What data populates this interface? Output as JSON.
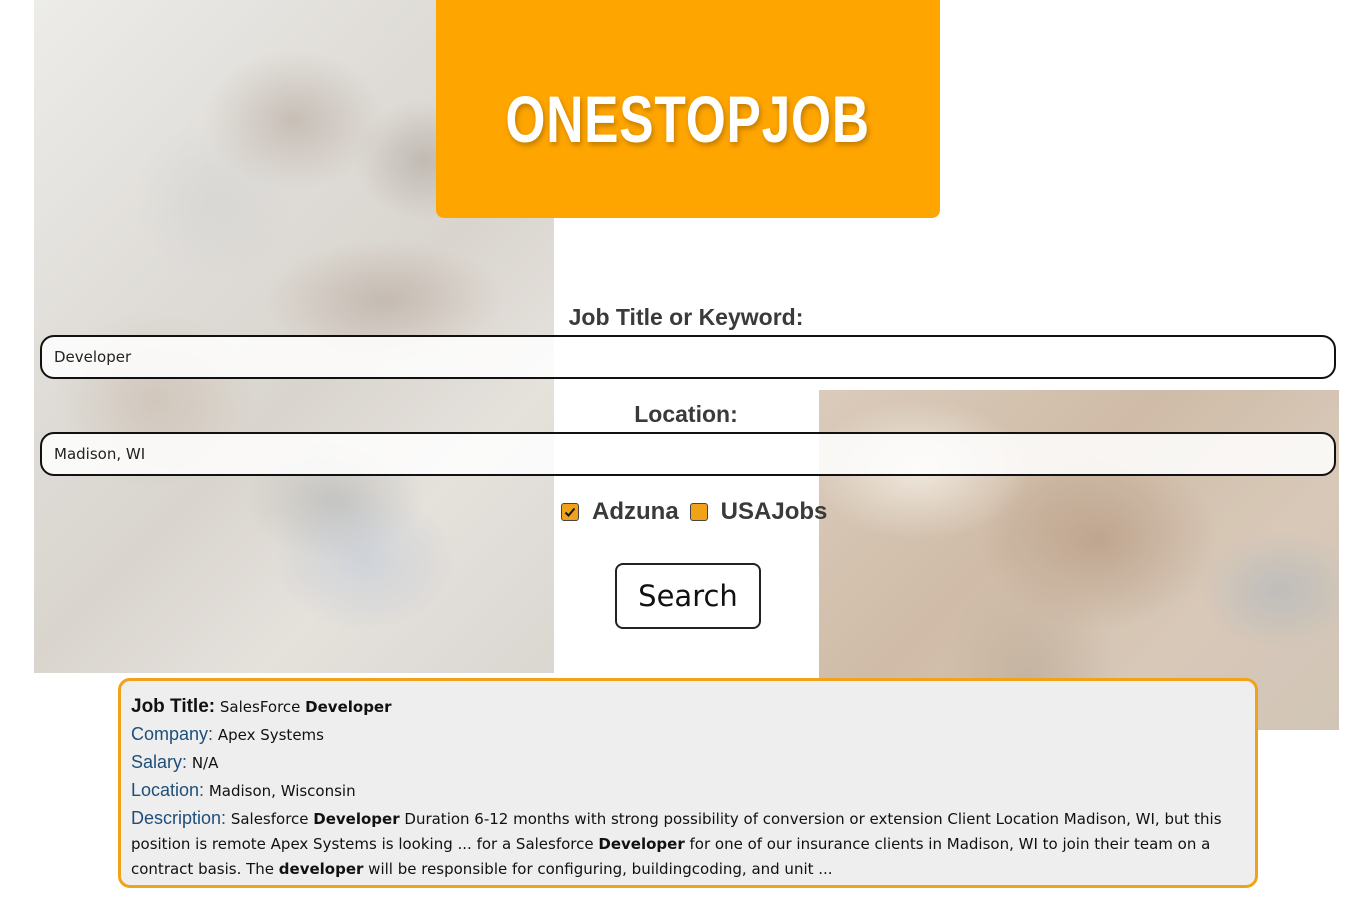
{
  "brand": {
    "title": "ONESTOPJOB",
    "color": "#ffa500"
  },
  "search": {
    "job_label": "Job Title or Keyword:",
    "job_value": "Developer",
    "location_label": "Location:",
    "location_value": "Madison, WI",
    "sources": [
      {
        "label": "Adzuna",
        "checked": true
      },
      {
        "label": "USAJobs",
        "checked": false
      }
    ],
    "button_label": "Search"
  },
  "result": {
    "job_title_key": "Job Title:",
    "job_title_pre": "SalesForce ",
    "job_title_highlight": "Developer",
    "company_key": "Company:",
    "company_value": "Apex Systems",
    "salary_key": "Salary:",
    "salary_value": "N/A",
    "location_key": "Location:",
    "location_value": "Madison, Wisconsin",
    "description_key": "Description:",
    "description_parts": [
      " Salesforce ",
      "Developer",
      " Duration 6-12 months with strong possibility of conversion or extension Client Location Madison, WI, but this position is remote Apex Systems is looking ... for a Salesforce ",
      "Developer",
      " for one of our insurance clients in Madison, WI to join their team on a contract basis. The ",
      "developer",
      " will be responsible for configuring, buildingcoding, and unit ..."
    ]
  },
  "colors": {
    "accent": "#ffa500",
    "card_border": "#f0a319",
    "key_text": "#1f4e79",
    "card_background": "#eeeeee"
  }
}
